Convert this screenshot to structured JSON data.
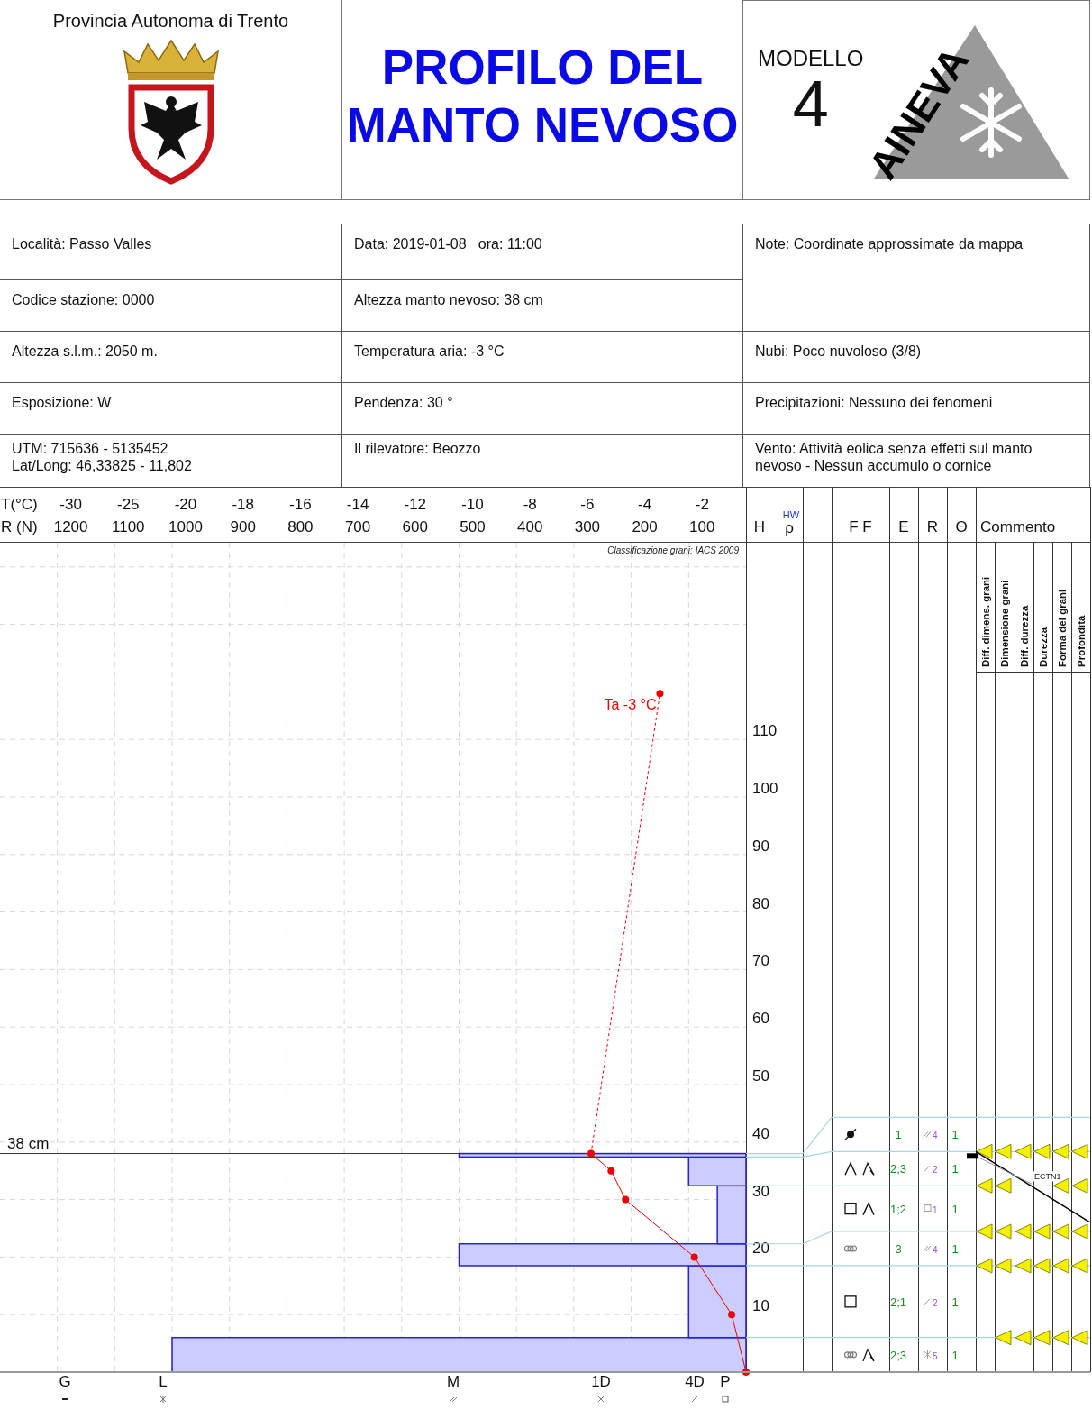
{
  "header": {
    "province": "Provincia Autonoma di Trento",
    "title": "PROFILO DEL MANTO NEVOSO",
    "model_label": "MODELLO",
    "model_number": "4",
    "logo_text": "AINEVA"
  },
  "info": {
    "column_1": [
      {
        "texts": [
          "Località: Passo Valles"
        ]
      },
      {
        "texts": [
          "Codice stazione: 0000"
        ]
      },
      {
        "texts": [
          "Altezza s.l.m.: 2050 m."
        ]
      },
      {
        "texts": [
          "Esposizione: W"
        ]
      },
      {
        "texts": [
          "UTM: 715636 - 5135452",
          "Lat/Long: 46,33825 - 11,802"
        ]
      }
    ],
    "column_2": [
      {
        "texts": [
          "Data: 2019-01-08   ora: 11:00"
        ]
      },
      {
        "texts": [
          "Altezza manto nevoso: 38 cm"
        ]
      },
      {
        "texts": [
          "Temperatura aria: -3 °C"
        ]
      },
      {
        "texts": [
          "Pendenza: 30 °"
        ]
      },
      {
        "texts": [
          "Il rilevatore: Beozzo"
        ]
      }
    ],
    "column_3": [
      {
        "texts": [
          "Note: Coordinate approssimate da mappa"
        ],
        "tall": true
      },
      {
        "texts": [
          "Nubi: Poco nuvoloso (3/8)"
        ],
        "tall": false
      },
      {
        "texts": [
          "Precipitazioni: Nessuno dei fenomeni"
        ],
        "tall": false
      },
      {
        "texts": [
          "Vento: Attività eolica senza effetti sul manto nevoso - Nessun accumulo o cornice"
        ],
        "tall": false
      }
    ]
  },
  "profile": {
    "temperature_scale": {
      "label": "T(°C)",
      "ticks": [
        "-30",
        "-25",
        "-20",
        "-18",
        "-16",
        "-14",
        "-12",
        "-10",
        "-8",
        "-6",
        "-4",
        "-2"
      ]
    },
    "resistance_scale": {
      "label": "R (N)",
      "ticks": [
        "1200",
        "1100",
        "1000",
        "900",
        "800",
        "700",
        "600",
        "500",
        "400",
        "300",
        "200",
        "100"
      ]
    },
    "height_scale": {
      "label": "H",
      "ticks": [
        "110",
        "100",
        "90",
        "80",
        "70",
        "60",
        "50",
        "40",
        "30",
        "20",
        "10"
      ]
    },
    "air_temperature_label": "Ta -3 °C",
    "snow_surface_label": "38 cm",
    "classification_note": "Classificazione grani: IACS 2009",
    "hardness_scale": [
      {
        "label": "G",
        "kind": "dash"
      },
      {
        "label": "L",
        "kind": "asterisk"
      },
      {
        "label": "M",
        "kind": "pencil"
      },
      {
        "label": "1D",
        "kind": "cross"
      },
      {
        "label": "4D",
        "kind": "slash"
      },
      {
        "label": "P",
        "kind": "square"
      }
    ]
  },
  "layer_table": {
    "density_header": {
      "top": "HW",
      "bottom": "ρ"
    },
    "columns": [
      "F F",
      "E",
      "R",
      "Θ",
      "Commento"
    ],
    "comment_columns": [
      "Diff. dimens. grani",
      "Dimensione grani",
      "Diff. durezza",
      "Durezza",
      "Forma dei grani",
      "Profondità"
    ],
    "layers": [
      {
        "grain_forms": [
          {
            "kind": "circle"
          }
        ],
        "size": "1",
        "hardness": {
          "kind": "pencil",
          "index": "4"
        },
        "wetness": "1"
      },
      {
        "grain_forms": [
          {
            "kind": "caret"
          },
          {
            "kind": "hookcaret"
          }
        ],
        "size": "2;3",
        "hardness": {
          "kind": "slash",
          "index": "2"
        },
        "wetness": "1"
      },
      {
        "grain_forms": [
          {
            "kind": "square"
          },
          {
            "kind": "caret"
          }
        ],
        "size": "1;2",
        "hardness": {
          "kind": "square",
          "index": "1"
        },
        "wetness": "1"
      },
      {
        "grain_forms": [
          {
            "kind": "cluster"
          }
        ],
        "size": "3",
        "hardness": {
          "kind": "pencil",
          "index": "4"
        },
        "wetness": "1"
      },
      {
        "grain_forms": [
          {
            "kind": "square"
          }
        ],
        "size": "2;1",
        "hardness": {
          "kind": "slash",
          "index": "2"
        },
        "wetness": "1"
      },
      {
        "grain_forms": [
          {
            "kind": "cluster"
          },
          {
            "kind": "hookcaret"
          }
        ],
        "size": "2;3",
        "hardness": {
          "kind": "asterisk",
          "index": "5"
        },
        "wetness": "1"
      }
    ],
    "boundaries": [
      {
        "markers": [
          {
            "kind": "triangle"
          },
          {
            "kind": "triangle"
          },
          {
            "kind": "triangle"
          },
          {
            "kind": "triangle"
          },
          {
            "kind": "triangle"
          },
          {
            "kind": "triangle"
          }
        ]
      },
      {
        "markers": [
          {
            "kind": "triangle"
          },
          {
            "kind": "triangle"
          },
          {
            "kind": "blank"
          },
          {
            "kind": "blank"
          },
          {
            "kind": "triangle"
          },
          {
            "kind": "triangle"
          }
        ]
      },
      {
        "markers": [
          {
            "kind": "triangle"
          },
          {
            "kind": "triangle"
          },
          {
            "kind": "triangle"
          },
          {
            "kind": "triangle"
          },
          {
            "kind": "triangle"
          },
          {
            "kind": "triangle"
          }
        ]
      },
      {
        "markers": [
          {
            "kind": "triangle"
          },
          {
            "kind": "triangle"
          },
          {
            "kind": "triangle"
          },
          {
            "kind": "triangle"
          },
          {
            "kind": "triangle"
          },
          {
            "kind": "triangle"
          }
        ]
      },
      {
        "markers": [
          {
            "kind": "blank"
          },
          {
            "kind": "triangle"
          },
          {
            "kind": "triangle"
          },
          {
            "kind": "triangle"
          },
          {
            "kind": "triangle"
          },
          {
            "kind": "triangle"
          }
        ]
      }
    ],
    "stability_tests": [
      {
        "label": "ECTN1"
      }
    ]
  }
}
